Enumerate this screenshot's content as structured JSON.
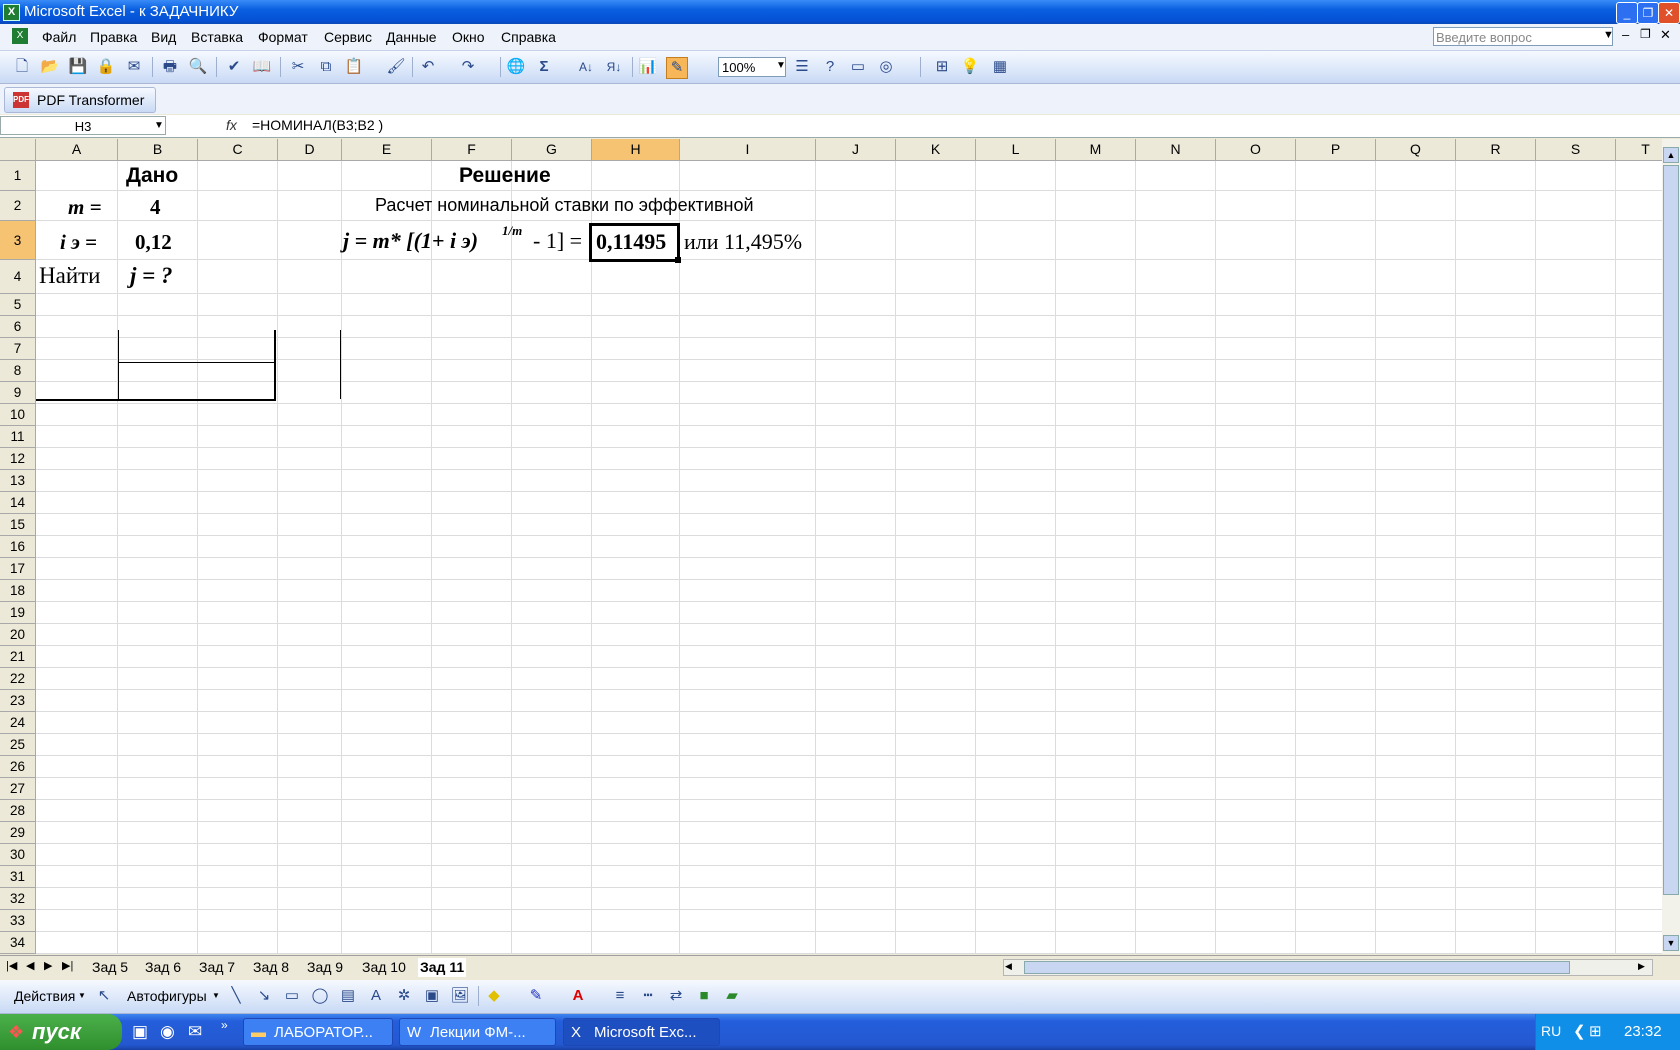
{
  "window": {
    "title": "Microsoft Excel - к ЗАДАЧНИКУ"
  },
  "menu": [
    "Файл",
    "Правка",
    "Вид",
    "Вставка",
    "Формат",
    "Сервис",
    "Данные",
    "Окно",
    "Справка"
  ],
  "ask_placeholder": "Введите вопрос",
  "toolbar": {
    "zoom": "100%",
    "pdf_label": "PDF Transformer"
  },
  "formula_bar": {
    "name_box": "H3",
    "fx": "fx",
    "formula": "=НОМИНАЛ(B3;B2  )"
  },
  "columns": [
    "A",
    "B",
    "C",
    "D",
    "E",
    "F",
    "G",
    "H",
    "I",
    "J",
    "K",
    "L",
    "M",
    "N",
    "O",
    "P",
    "Q",
    "R",
    "S",
    "T"
  ],
  "selected": {
    "column": "H",
    "row": "3"
  },
  "cells": {
    "B1": "Дано",
    "A2": "m =",
    "B2": "4",
    "A3": "i э  =",
    "B3": "0,12",
    "A4": "Найти",
    "B4": "j = ?",
    "F1": "Решение",
    "E2": "Расчет номинальной ставки по эффективной",
    "E3_formula_main": "j  = m* [(1+ i э)",
    "E3_power": "1/m",
    "E3_tail": "- 1]  =",
    "H3": "0,11495",
    "I3": "или 11,495%"
  },
  "sheet_tabs": [
    "Зад 5",
    "Зад 6",
    "Зад 7",
    "Зад 8",
    "Зад 9",
    "Зад 10",
    "Зад 11"
  ],
  "active_tab": "Зад 11",
  "drawing": {
    "actions": "Действия",
    "autoshapes": "Автофигуры"
  },
  "taskbar": {
    "start": "пуск",
    "tasks": [
      "ЛАБОРАТОР...",
      "Лекции ФМ-...",
      "Microsoft Exc..."
    ],
    "lang": "RU",
    "clock": "23:32"
  }
}
